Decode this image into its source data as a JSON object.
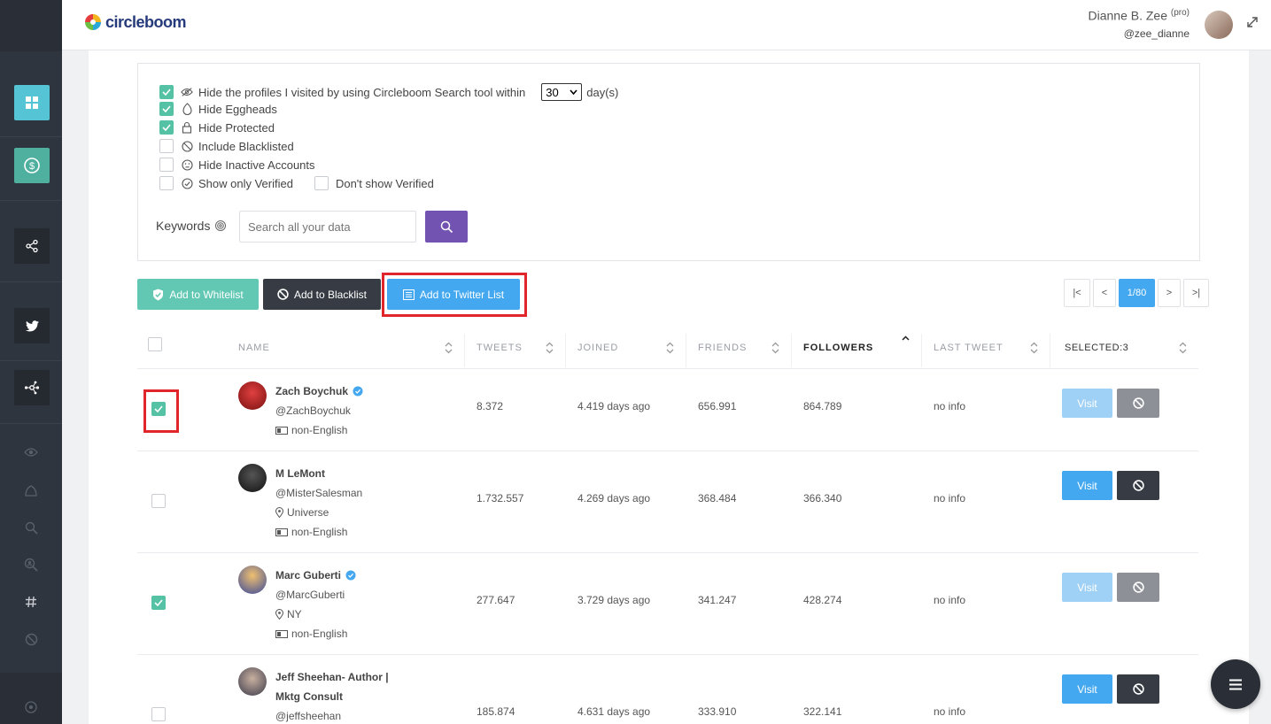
{
  "header": {
    "logo_text": "circleboom",
    "user_name": "Dianne B. Zee",
    "user_badge": "(pro)",
    "user_handle": "@zee_dianne"
  },
  "sidebar": {
    "main_items": [
      "dashboard-icon",
      "dollar-badge-icon",
      "share-icon",
      "twitter-icon",
      "network-icon"
    ],
    "sub_items": [
      "eye-icon",
      "egghead-icon",
      "search-icon",
      "zoom-user-icon",
      "hashtag-icon",
      "block-icon"
    ],
    "bottom_item": "circle-icon"
  },
  "filters": {
    "visited_label": "Hide the profiles I visited by using Circleboom Search tool within",
    "visited_days": "30",
    "days_suffix": "day(s)",
    "eggheads_label": "Hide Eggheads",
    "protected_label": "Hide Protected",
    "blacklisted_label": "Include Blacklisted",
    "inactive_label": "Hide Inactive Accounts",
    "verified_label": "Show only Verified",
    "no_verified_label": "Don't show Verified",
    "keywords_label": "Keywords",
    "search_placeholder": "Search all your data"
  },
  "actions": {
    "whitelist": "Add to Whitelist",
    "blacklist": "Add to Blacklist",
    "twitter_list": "Add to Twitter List"
  },
  "pagination": {
    "first": "|<",
    "prev": "<",
    "current": "1/80",
    "next": ">",
    "last": ">|"
  },
  "table": {
    "columns": [
      "NAME",
      "TWEETS",
      "JOINED",
      "FRIENDS",
      "FOLLOWERS",
      "LAST TWEET",
      "SELECTED:3"
    ],
    "rows": [
      {
        "name": "Zach Boychuk",
        "verified": true,
        "handle": "@ZachBoychuk",
        "location": "",
        "language": "non-English",
        "tweets": "8.372",
        "joined": "4.419 days ago",
        "friends": "656.991",
        "followers": "864.789",
        "last_tweet": "no info",
        "selected": true,
        "visit": "Visit"
      },
      {
        "name": "M LeMont",
        "verified": false,
        "handle": "@MisterSalesman",
        "location": "Universe",
        "language": "non-English",
        "tweets": "1.732.557",
        "joined": "4.269 days ago",
        "friends": "368.484",
        "followers": "366.340",
        "last_tweet": "no info",
        "selected": false,
        "visit": "Visit"
      },
      {
        "name": "Marc Guberti",
        "verified": true,
        "handle": "@MarcGuberti",
        "location": "NY",
        "language": "non-English",
        "tweets": "277.647",
        "joined": "3.729 days ago",
        "friends": "341.247",
        "followers": "428.274",
        "last_tweet": "no info",
        "selected": true,
        "visit": "Visit"
      },
      {
        "name_line1": "Jeff Sheehan- Author |",
        "name_line2": "Mktg Consult",
        "verified": false,
        "handle": "@jeffsheehan",
        "tweets": "185.874",
        "joined": "4.631 days ago",
        "friends": "333.910",
        "followers": "322.141",
        "last_tweet": "no info",
        "selected": false,
        "visit": "Visit"
      }
    ]
  },
  "colors": {
    "teal": "#55c5d6",
    "green_check": "#56c2a5",
    "twitter_blue": "#43a8ef",
    "purple": "#7353b1",
    "dark": "#373c44",
    "highlight_red": "#e1262b"
  }
}
